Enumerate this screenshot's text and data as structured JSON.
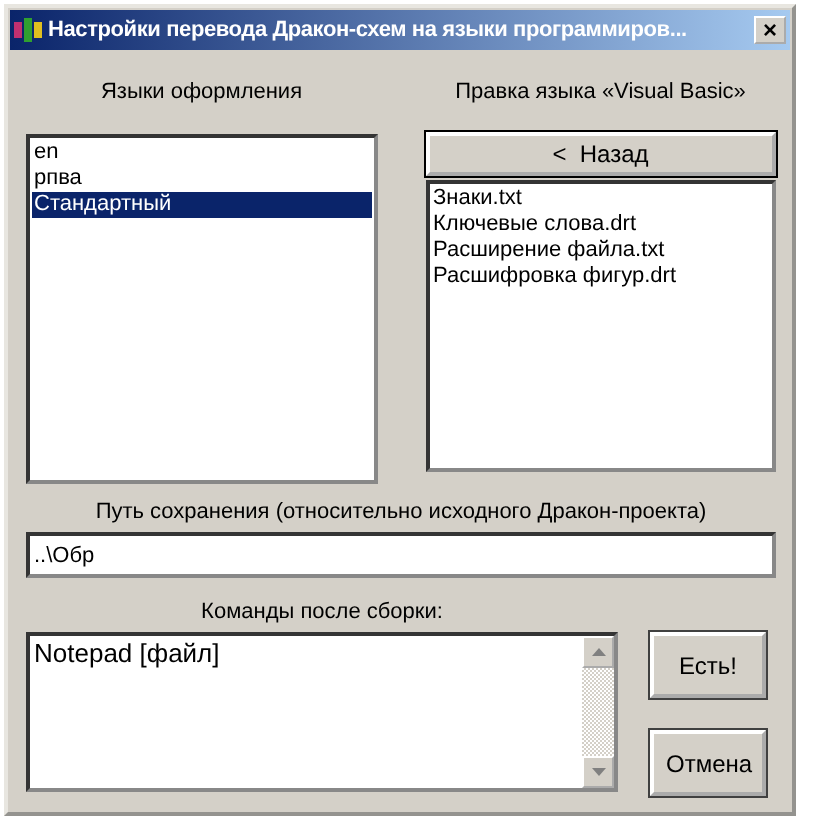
{
  "window": {
    "title": "Настройки перевода Дракон-схем на языки программиров...",
    "close": "×"
  },
  "languages": {
    "label": "Языки оформления",
    "items": [
      {
        "text": "en",
        "selected": false
      },
      {
        "text": "рпва",
        "selected": false
      },
      {
        "text": "Стандартный",
        "selected": true
      }
    ]
  },
  "language_edit": {
    "label": "Правка языка «Visual Basic»",
    "back_button": "<  Назад",
    "files": [
      "Знаки.txt",
      "Ключевые слова.drt",
      "Расширение файла.txt",
      "Расшифровка фигур.drt"
    ]
  },
  "save_path": {
    "label": "Путь сохранения (относительно исходного Дракон-проекта)",
    "value": "..\\Обр"
  },
  "commands": {
    "label": "Команды после сборки:",
    "value": "Notepad [файл]"
  },
  "buttons": [
    "Есть!",
    "Отмена"
  ]
}
